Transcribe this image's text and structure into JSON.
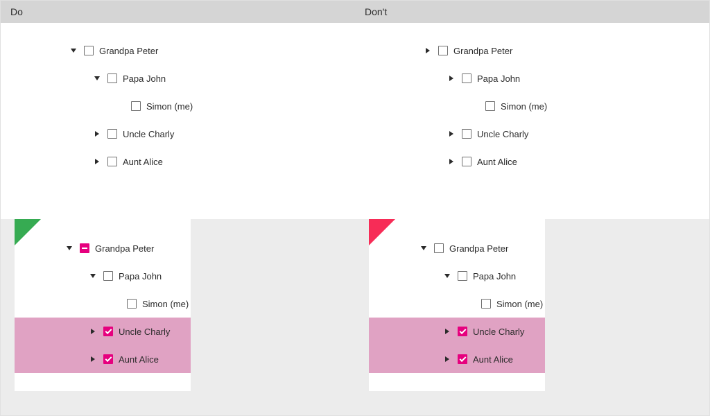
{
  "headers": {
    "do": "Do",
    "dont": "Don't"
  },
  "corner_colors": {
    "good": "#36ab52",
    "bad": "#f72c57"
  },
  "checkbox_color": "#e6007e",
  "highlight_color": "#e0a2c3",
  "panels": {
    "do_top": {
      "corner": "good",
      "nodes": [
        {
          "depth": 0,
          "arrow": "down",
          "state": "unchecked",
          "label": "Grandpa Peter",
          "highlight": false
        },
        {
          "depth": 1,
          "arrow": "down",
          "state": "unchecked",
          "label": "Papa John",
          "highlight": false
        },
        {
          "depth": 2,
          "arrow": "none",
          "state": "unchecked",
          "label": "Simon (me)",
          "highlight": false
        },
        {
          "depth": 1,
          "arrow": "right",
          "state": "unchecked",
          "label": "Uncle Charly",
          "highlight": false
        },
        {
          "depth": 1,
          "arrow": "right",
          "state": "unchecked",
          "label": "Aunt Alice",
          "highlight": false
        }
      ]
    },
    "dont_top": {
      "corner": "bad",
      "nodes": [
        {
          "depth": 0,
          "arrow": "right",
          "state": "unchecked",
          "label": "Grandpa Peter",
          "highlight": false
        },
        {
          "depth": 1,
          "arrow": "right",
          "state": "unchecked",
          "label": "Papa John",
          "highlight": false
        },
        {
          "depth": 2,
          "arrow": "none",
          "state": "unchecked",
          "label": "Simon (me)",
          "highlight": false
        },
        {
          "depth": 1,
          "arrow": "right",
          "state": "unchecked",
          "label": "Uncle Charly",
          "highlight": false
        },
        {
          "depth": 1,
          "arrow": "right",
          "state": "unchecked",
          "label": "Aunt Alice",
          "highlight": false
        }
      ]
    },
    "do_bottom": {
      "corner": "good",
      "nodes": [
        {
          "depth": 0,
          "arrow": "down",
          "state": "mixed",
          "label": "Grandpa Peter",
          "highlight": false
        },
        {
          "depth": 1,
          "arrow": "down",
          "state": "unchecked",
          "label": "Papa John",
          "highlight": false
        },
        {
          "depth": 2,
          "arrow": "none",
          "state": "unchecked",
          "label": "Simon (me)",
          "highlight": false
        },
        {
          "depth": 1,
          "arrow": "right",
          "state": "checked",
          "label": "Uncle Charly",
          "highlight": true
        },
        {
          "depth": 1,
          "arrow": "right",
          "state": "checked",
          "label": "Aunt Alice",
          "highlight": true
        }
      ]
    },
    "dont_bottom": {
      "corner": "bad",
      "nodes": [
        {
          "depth": 0,
          "arrow": "down",
          "state": "unchecked",
          "label": "Grandpa Peter",
          "highlight": false
        },
        {
          "depth": 1,
          "arrow": "down",
          "state": "unchecked",
          "label": "Papa John",
          "highlight": false
        },
        {
          "depth": 2,
          "arrow": "none",
          "state": "unchecked",
          "label": "Simon (me)",
          "highlight": false
        },
        {
          "depth": 1,
          "arrow": "right",
          "state": "checked",
          "label": "Uncle Charly",
          "highlight": true
        },
        {
          "depth": 1,
          "arrow": "right",
          "state": "checked",
          "label": "Aunt Alice",
          "highlight": true
        }
      ]
    }
  }
}
